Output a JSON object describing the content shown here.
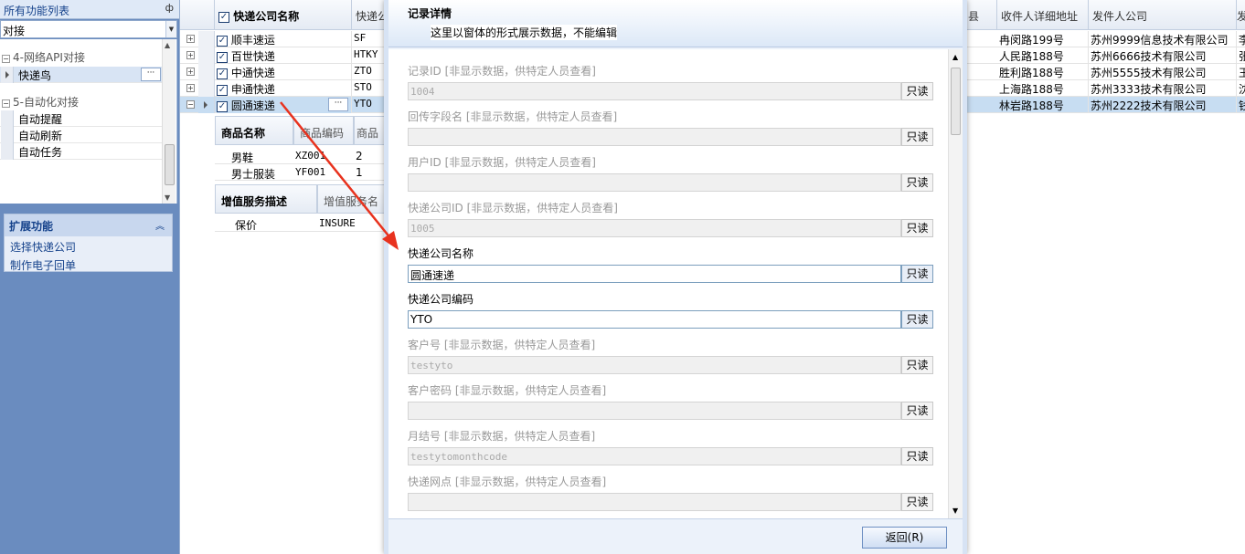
{
  "left_panel": {
    "title": "所有功能列表",
    "pin_glyph": "ф",
    "search_value": "对接",
    "groups": [
      {
        "label": "4-网络API对接",
        "items": [
          {
            "label": "快递鸟",
            "selected": true
          }
        ]
      },
      {
        "label": "5-自动化对接",
        "items": [
          {
            "label": "自动提醒"
          },
          {
            "label": "自动刷新"
          },
          {
            "label": "自动任务"
          }
        ]
      }
    ],
    "dots": "···",
    "ext": {
      "title": "扩展功能",
      "links": [
        "选择快递公司",
        "制作电子回单"
      ]
    }
  },
  "grid": {
    "headers": {
      "name": "快递公司名称",
      "code": "快递公",
      "county": "县",
      "addr": "收件人详细地址",
      "company": "发件人公司",
      "last": "发"
    },
    "rows": [
      {
        "name": "顺丰速运",
        "code": "SF",
        "addr": "冉闵路199号",
        "company": "苏州9999信息技术有限公司",
        "last": "李"
      },
      {
        "name": "百世快递",
        "code": "HTKY",
        "addr": "人民路188号",
        "company": "苏州6666技术有限公司",
        "last": "张"
      },
      {
        "name": "中通快递",
        "code": "ZTO",
        "addr": "胜利路188号",
        "company": "苏州5555技术有限公司",
        "last": "王"
      },
      {
        "name": "申通快递",
        "code": "STO",
        "addr": "上海路188号",
        "company": "苏州3333技术有限公司",
        "last": "沈"
      },
      {
        "name": "圆通速递",
        "code": "YTO",
        "addr": "林岩路188号",
        "company": "苏州2222技术有限公司",
        "last": "钱"
      }
    ],
    "goods": {
      "headers": [
        "商品名称",
        "商品编码",
        "商品"
      ],
      "rows": [
        [
          "男鞋",
          "XZ001",
          "2"
        ],
        [
          "男士服装",
          "YF001",
          "1"
        ]
      ]
    },
    "services": {
      "headers": [
        "增值服务描述",
        "增值服务名"
      ],
      "rows": [
        [
          "保价",
          "INSURE"
        ]
      ]
    }
  },
  "dialog": {
    "title": "记录详情",
    "subtitle": "这里以窗体的形式展示数据，不能编辑",
    "readonly_label": "只读",
    "fields": [
      {
        "label": "记录ID [非显示数据，供特定人员查看]",
        "value": "1004",
        "enabled": false
      },
      {
        "label": "回传字段名 [非显示数据，供特定人员查看]",
        "value": "",
        "enabled": false
      },
      {
        "label": "用户ID [非显示数据，供特定人员查看]",
        "value": "",
        "enabled": false
      },
      {
        "label": "快递公司ID [非显示数据，供特定人员查看]",
        "value": "1005",
        "enabled": false
      },
      {
        "label": "快递公司名称",
        "value": "圆通速递",
        "enabled": true
      },
      {
        "label": "快递公司编码",
        "value": "YTO",
        "enabled": true
      },
      {
        "label": "客户号 [非显示数据，供特定人员查看]",
        "value": "testyto",
        "enabled": false
      },
      {
        "label": "客户密码 [非显示数据，供特定人员查看]",
        "value": "",
        "enabled": false
      },
      {
        "label": "月结号 [非显示数据，供特定人员查看]",
        "value": "testytomonthcode",
        "enabled": false
      },
      {
        "label": "快递网点 [非显示数据，供特定人员查看]",
        "value": "",
        "enabled": false
      }
    ],
    "back_button": "返回(R)"
  },
  "colors": {
    "sidebar_bg": "#6a8cbf",
    "selected_row": "#c7ddf2",
    "annotation_arrow": "#e8321e"
  }
}
